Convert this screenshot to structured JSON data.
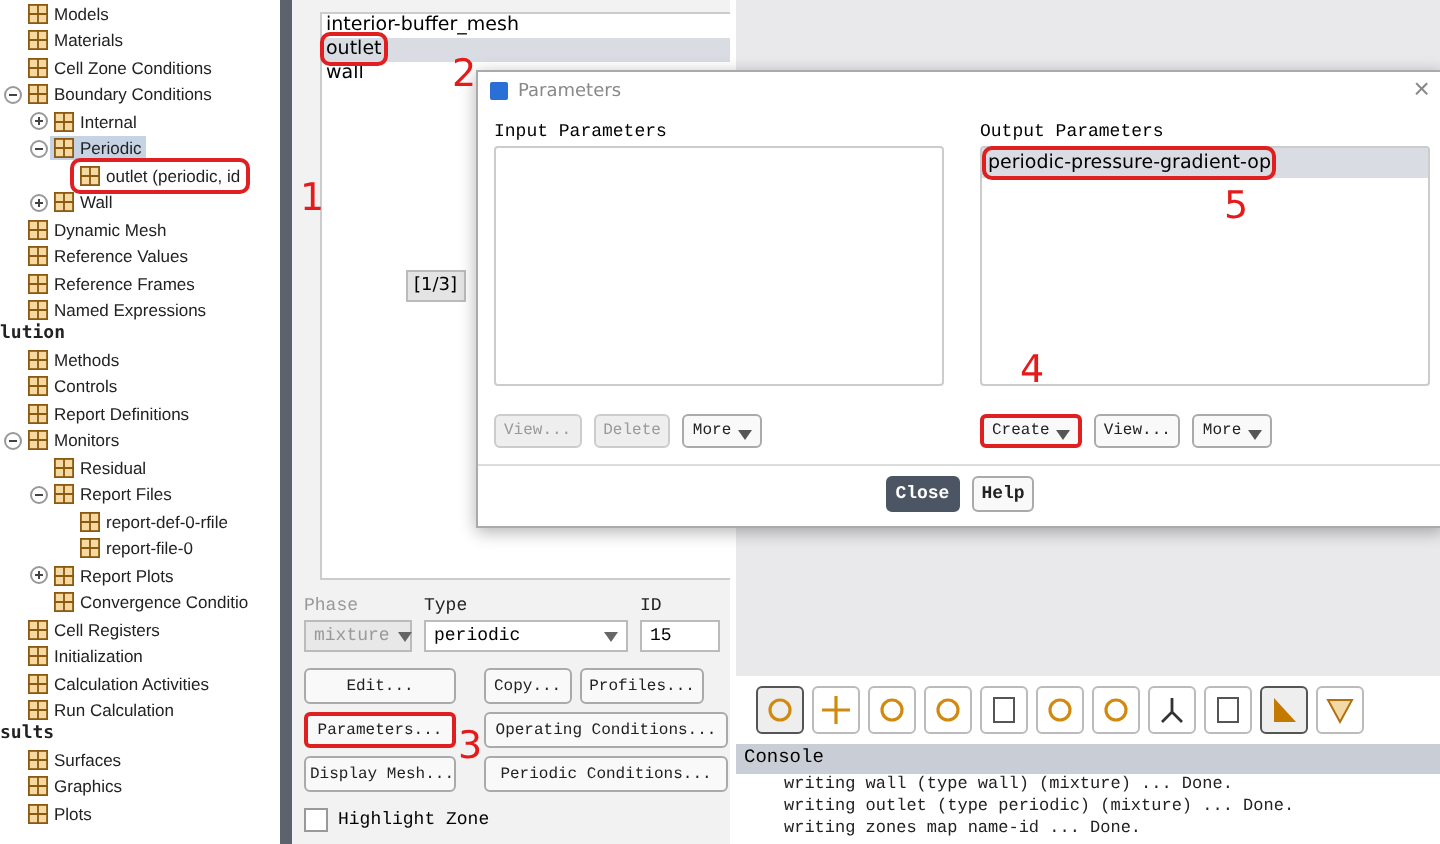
{
  "tree": [
    {
      "kind": "item",
      "label": "Models",
      "selected": false
    },
    {
      "kind": "item",
      "label": "Materials",
      "selected": false
    },
    {
      "kind": "item",
      "label": "Cell Zone Conditions",
      "selected": false
    },
    {
      "kind": "item",
      "label": "Boundary Conditions",
      "selected": false,
      "expanded": true,
      "children": [
        {
          "kind": "item",
          "label": "Internal",
          "selected": false,
          "expanded": false
        },
        {
          "kind": "item",
          "label": "Periodic",
          "selected": true,
          "expanded": true,
          "children": [
            {
              "kind": "item",
              "label": "outlet (periodic, id",
              "selected": false,
              "highlighted": true
            }
          ]
        },
        {
          "kind": "item",
          "label": "Wall",
          "selected": false,
          "expanded": false
        }
      ]
    },
    {
      "kind": "item",
      "label": "Dynamic Mesh",
      "selected": false
    },
    {
      "kind": "item",
      "label": "Reference Values",
      "selected": false
    },
    {
      "kind": "item",
      "label": "Reference Frames",
      "selected": false
    },
    {
      "kind": "item",
      "label": "Named Expressions",
      "selected": false
    },
    {
      "kind": "section",
      "label": "lution"
    },
    {
      "kind": "item",
      "label": "Methods",
      "selected": false
    },
    {
      "kind": "item",
      "label": "Controls",
      "selected": false
    },
    {
      "kind": "item",
      "label": "Report Definitions",
      "selected": false
    },
    {
      "kind": "item",
      "label": "Monitors",
      "selected": false,
      "expanded": true,
      "children": [
        {
          "kind": "item",
          "label": "Residual",
          "selected": false
        },
        {
          "kind": "item",
          "label": "Report Files",
          "selected": false,
          "expanded": true,
          "children": [
            {
              "kind": "item",
              "label": "report-def-0-rfile",
              "selected": false
            },
            {
              "kind": "item",
              "label": "report-file-0",
              "selected": false
            }
          ]
        },
        {
          "kind": "item",
          "label": "Report Plots",
          "selected": false,
          "expanded": false
        },
        {
          "kind": "item",
          "label": "Convergence Conditio",
          "selected": false
        }
      ]
    },
    {
      "kind": "item",
      "label": "Cell Registers",
      "selected": false
    },
    {
      "kind": "item",
      "label": "Initialization",
      "selected": false
    },
    {
      "kind": "item",
      "label": "Calculation Activities",
      "selected": false
    },
    {
      "kind": "item",
      "label": "Run Calculation",
      "selected": false
    },
    {
      "kind": "section",
      "label": "sults"
    },
    {
      "kind": "item",
      "label": "Surfaces",
      "selected": false
    },
    {
      "kind": "item",
      "label": "Graphics",
      "selected": false
    },
    {
      "kind": "item",
      "label": "Plots",
      "selected": false
    }
  ],
  "zones": [
    {
      "label": "interior-buffer_mesh",
      "selected": false,
      "highlighted": false
    },
    {
      "label": "outlet",
      "selected": true,
      "highlighted": true
    },
    {
      "label": "wall",
      "selected": false,
      "highlighted": false
    }
  ],
  "pager": "[1/3]",
  "phase": {
    "label": "Phase",
    "value": "mixture",
    "disabled": true
  },
  "type": {
    "label": "Type",
    "value": "periodic"
  },
  "id": {
    "label": "ID",
    "value": "15"
  },
  "zone_buttons": [
    {
      "label": "Edit...",
      "highlighted": false
    },
    {
      "label": "Copy...",
      "highlighted": false
    },
    {
      "label": "Profiles...",
      "highlighted": false
    },
    {
      "label": "Parameters...",
      "highlighted": true
    },
    {
      "label": "Operating Conditions...",
      "highlighted": false
    },
    {
      "label": "Display Mesh...",
      "highlighted": false
    },
    {
      "label": "Periodic Conditions...",
      "highlighted": false
    }
  ],
  "highlight_zone": {
    "label": "Highlight Zone",
    "checked": false
  },
  "toolbar": [
    {
      "pressed": true
    },
    {
      "pressed": false
    },
    {
      "pressed": false
    },
    {
      "pressed": false
    },
    {
      "pressed": false
    },
    {
      "pressed": false
    },
    {
      "pressed": false
    },
    {
      "pressed": false
    },
    {
      "pressed": false
    },
    {
      "pressed": true
    },
    {
      "pressed": false
    }
  ],
  "console": {
    "title": "Console",
    "lines": [
      "writing wall (type wall) (mixture) ... Done.",
      "writing outlet (type periodic) (mixture) ... Done.",
      "writing zones map name-id ... Done."
    ]
  },
  "dialog": {
    "title": "Parameters",
    "close": "×",
    "input": {
      "title": "Input Parameters",
      "buttons": [
        {
          "label": "View...",
          "disabled": true,
          "menu": false,
          "highlighted": false
        },
        {
          "label": "Delete",
          "disabled": true,
          "menu": false,
          "highlighted": false
        },
        {
          "label": "More",
          "disabled": false,
          "menu": true,
          "highlighted": false
        }
      ]
    },
    "output": {
      "title": "Output Parameters",
      "items": [
        {
          "label": "periodic-pressure-gradient-op",
          "selected": true,
          "highlighted": true
        }
      ],
      "buttons": [
        {
          "label": "Create",
          "disabled": false,
          "menu": true,
          "highlighted": true
        },
        {
          "label": "View...",
          "disabled": false,
          "menu": false,
          "highlighted": false
        },
        {
          "label": "More",
          "disabled": false,
          "menu": true,
          "highlighted": false
        }
      ]
    },
    "footer": [
      {
        "label": "Close",
        "primary": true
      },
      {
        "label": "Help",
        "primary": false
      }
    ]
  },
  "annotations": [
    "1",
    "2",
    "3",
    "4",
    "5"
  ]
}
